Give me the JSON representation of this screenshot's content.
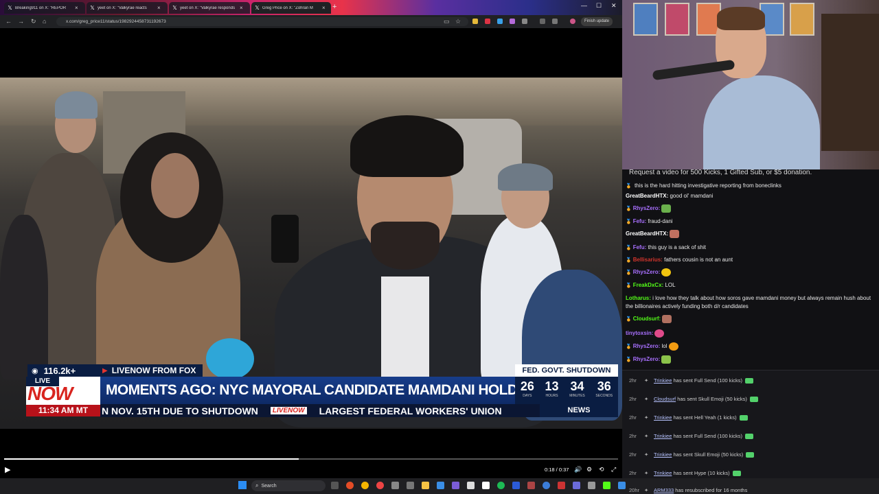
{
  "browser": {
    "tabs": [
      {
        "title": "Breaking911 on X: \"REPOR",
        "favicon": "x-icon"
      },
      {
        "title": "yeet on X: \"Valkyrae reacts",
        "favicon": "x-icon"
      },
      {
        "title": "yeet on X: \"Valkyrae responds",
        "favicon": "x-icon"
      },
      {
        "title": "Greg Price on X: \"Zohran M",
        "favicon": "x-icon"
      }
    ],
    "new_tab": "+",
    "url": "x.com/greg_price11/status/1982924458731192673",
    "finish_update": "Finish update"
  },
  "video": {
    "viewers": "116.2k+",
    "source": "LIVENOW FROM FOX",
    "live_small": "LIVE",
    "live_big": "NOW",
    "time": "11:34 AM MT",
    "headline": "MOMENTS AGO: NYC MAYORAL CANDIDATE MAMDANI HOLDS RALLY",
    "countdown_title": "FED. GOVT. SHUTDOWN",
    "countdown": [
      {
        "n": "26",
        "u": "DAYS"
      },
      {
        "n": "13",
        "u": "HOURS"
      },
      {
        "n": "34",
        "u": "MINUTES"
      },
      {
        "n": "36",
        "u": "SECONDS"
      }
    ],
    "ticker_left": "N NOV. 15TH DUE TO SHUTDOWN",
    "ticker_logo": "LIVENOW",
    "ticker_right": "LARGEST FEDERAL WORKERS' UNION",
    "news": "NEWS",
    "timecode": "0:18 / 0:37",
    "progress": 0.48
  },
  "chat": {
    "banner": "Request a video for 500 Kicks, 1 Gifted Sub, or $5 donation.",
    "messages": [
      {
        "user": "",
        "text": "this is the hard hitting investigative reporting from boneclinks",
        "color": "#9147ff"
      },
      {
        "user": "GreatBeardHTX:",
        "text": "good ol' mamdani",
        "color": "#ffffff"
      },
      {
        "user": "RhysZero:",
        "text": "",
        "color": "#a970ff"
      },
      {
        "user": "Fefu:",
        "text": "fraud-dani",
        "color": "#a970ff"
      },
      {
        "user": "GreatBeardHTX:",
        "text": "",
        "color": "#ffffff"
      },
      {
        "user": "Fefu:",
        "text": "this guy is a sack of shit",
        "color": "#a970ff"
      },
      {
        "user": "Bellisarius:",
        "text": "fathers cousin is not an aunt",
        "color": "#d0342c"
      },
      {
        "user": "RhysZero:",
        "text": "",
        "color": "#a970ff"
      },
      {
        "user": "FreakDxCx:",
        "text": "LOL",
        "color": "#53fc18"
      },
      {
        "user": "Lotharus:",
        "text": "i love how they talk about how soros gave mamdani money but always remain hush about the billionaires actively funding both d/r candidates",
        "color": "#53fc18"
      },
      {
        "user": "Cloudsurf:",
        "text": "",
        "color": "#53fc18"
      },
      {
        "user": "tinytoxsin:",
        "text": "",
        "color": "#a970ff"
      },
      {
        "user": "RhysZero:",
        "text": "lol",
        "color": "#a970ff"
      },
      {
        "user": "RhysZero:",
        "text": "",
        "color": "#a970ff"
      }
    ],
    "events": [
      {
        "ago": "2hr",
        "user": "Trinkiee",
        "text": "has sent Full Send (100 kicks)"
      },
      {
        "ago": "2hr",
        "user": "Cloudsurf",
        "text": "has sent Skull Emoji (50 kicks)"
      },
      {
        "ago": "2hr",
        "user": "Trinkiee",
        "text": "has sent Hell Yeah (1 kicks)"
      },
      {
        "ago": "2hr",
        "user": "Trinkiee",
        "text": "has sent Full Send (100 kicks)"
      },
      {
        "ago": "2hr",
        "user": "Trinkiee",
        "text": "has sent Skull Emoji (50 kicks)"
      },
      {
        "ago": "2hr",
        "user": "Trinkiee",
        "text": "has sent Hype (10 kicks)"
      },
      {
        "ago": "20hr",
        "user": "ARM333",
        "text": "has resubscribed for 16 months"
      }
    ]
  },
  "taskbar": {
    "search_label": "Search"
  }
}
